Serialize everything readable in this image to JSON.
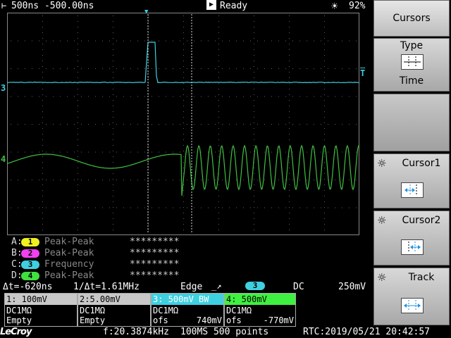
{
  "status_bar": {
    "timebase": "500ns -500.00ns",
    "run_status": "Ready",
    "battery": "92%",
    "timebase_icon": "horizontal-scale-icon",
    "run_icon": "play-icon",
    "battery_icon": "sun-icon"
  },
  "channels_markers": {
    "ch3": "3",
    "ch4": "4",
    "trigger_level": "T",
    "trigger_pos": "▼"
  },
  "measurements": [
    {
      "slot": "A:",
      "ch": "1",
      "name": "Peak-Peak",
      "value": "*********",
      "color": "#f0f020"
    },
    {
      "slot": "B:",
      "ch": "2",
      "name": "Peak-Peak",
      "value": "*********",
      "color": "#f040f0"
    },
    {
      "slot": "C:",
      "ch": "3",
      "name": "Frequency",
      "value": "*********",
      "color": "#3fd0e0"
    },
    {
      "slot": "D:",
      "ch": "4",
      "name": "Peak-Peak",
      "value": "*********",
      "color": "#40e040"
    }
  ],
  "cursor_readout": {
    "delta_t": "Δt=-620ns",
    "inv_delta_t": "1/Δt=1.61MHz"
  },
  "trigger": {
    "type": "Edge",
    "channel": "3",
    "coupling": "DC",
    "level": "250mV"
  },
  "channel_boxes": [
    {
      "header": "1: 100mV",
      "coupling": "DC1MΩ",
      "l3": "Empty",
      "l3r": "",
      "bg": "#f0f020"
    },
    {
      "header": "2:5.00mV",
      "coupling": "DC1MΩ",
      "l3": "Empty",
      "l3r": "",
      "bg": "#f040f0"
    },
    {
      "header": "3: 500mV  BW",
      "coupling": "DC1MΩ",
      "l3": "ofs",
      "l3r": "740mV",
      "bg": "#3fd0e0"
    },
    {
      "header": "4: 500mV",
      "coupling": "DC1MΩ",
      "l3": "ofs",
      "l3r": "-770mV",
      "bg": "#40f040"
    }
  ],
  "bottom_bar": {
    "logo": "LeCroy",
    "frequency": "f:20.3874kHz",
    "sample_info": "100MS 500 points",
    "rtc": "RTC:2019/05/21 20:42:57"
  },
  "menu": {
    "title": "Cursors",
    "type_label": "Type",
    "type_value": "Time",
    "cursor1_label": "Cursor1",
    "cursor2_label": "Cursor2",
    "track_label": "Track"
  },
  "colors": {
    "ch3": "#3fd0e0",
    "ch4": "#40c040",
    "grid": "#606060"
  }
}
